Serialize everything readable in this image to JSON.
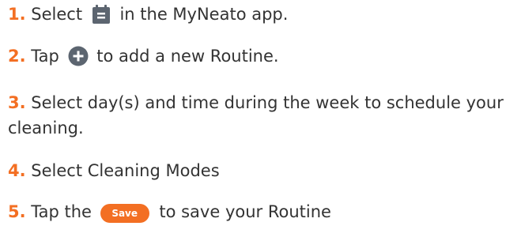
{
  "colors": {
    "accent": "#f36f23",
    "icon": "#5c6570",
    "text": "#333333"
  },
  "steps": [
    {
      "num": "1.",
      "before": "Select",
      "icon": "calendar-icon",
      "after": "in the MyNeato app."
    },
    {
      "num": "2.",
      "before": "Tap",
      "icon": "plus-circle-icon",
      "after": "to add a new Routine."
    },
    {
      "num": "3.",
      "text": "Select day(s) and time during the week to schedule your cleaning."
    },
    {
      "num": "4.",
      "text": "Select Cleaning Modes"
    },
    {
      "num": "5.",
      "before": "Tap the",
      "button_label": "Save",
      "after": "to save your Routine"
    }
  ]
}
